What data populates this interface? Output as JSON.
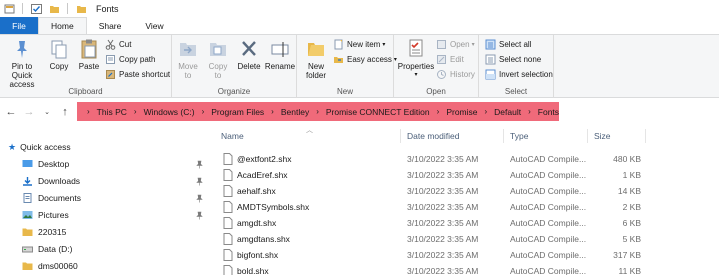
{
  "window": {
    "title": "Fonts"
  },
  "tabs": {
    "file": "File",
    "home": "Home",
    "share": "Share",
    "view": "View"
  },
  "ribbon": {
    "clipboard": {
      "label": "Clipboard",
      "pin_line1": "Pin to Quick",
      "pin_line2": "access",
      "copy": "Copy",
      "paste": "Paste",
      "cut": "Cut",
      "copy_path": "Copy path",
      "paste_shortcut": "Paste shortcut"
    },
    "organize": {
      "label": "Organize",
      "move_line1": "Move",
      "move_line2": "to",
      "copy_line1": "Copy",
      "copy_line2": "to",
      "delete": "Delete",
      "rename": "Rename"
    },
    "new": {
      "label": "New",
      "folder_line1": "New",
      "folder_line2": "folder",
      "new_item": "New item",
      "easy_access": "Easy access"
    },
    "open": {
      "label": "Open",
      "properties": "Properties",
      "open": "Open",
      "edit": "Edit",
      "history": "History"
    },
    "select": {
      "label": "Select",
      "select_all": "Select all",
      "select_none": "Select none",
      "invert": "Invert selection"
    }
  },
  "address": {
    "crumbs": [
      "This PC",
      "Windows (C:)",
      "Program Files",
      "Bentley",
      "Promise CONNECT Edition",
      "Promise",
      "Default",
      "Fonts"
    ],
    "highlight_color": "#f06a7a"
  },
  "nav": {
    "quick_access": "Quick access",
    "items": [
      "Desktop",
      "Downloads",
      "Documents",
      "Pictures",
      "220315",
      "Data (D:)",
      "dms00060"
    ]
  },
  "columns": {
    "name": "Name",
    "date": "Date modified",
    "type": "Type",
    "size": "Size"
  },
  "files": [
    {
      "name": "@extfont2.shx",
      "date": "3/10/2022 3:35 AM",
      "type": "AutoCAD Compile...",
      "size": "480 KB"
    },
    {
      "name": "AcadEref.shx",
      "date": "3/10/2022 3:35 AM",
      "type": "AutoCAD Compile...",
      "size": "1 KB"
    },
    {
      "name": "aehalf.shx",
      "date": "3/10/2022 3:35 AM",
      "type": "AutoCAD Compile...",
      "size": "14 KB"
    },
    {
      "name": "AMDTSymbols.shx",
      "date": "3/10/2022 3:35 AM",
      "type": "AutoCAD Compile...",
      "size": "2 KB"
    },
    {
      "name": "amgdt.shx",
      "date": "3/10/2022 3:35 AM",
      "type": "AutoCAD Compile...",
      "size": "6 KB"
    },
    {
      "name": "amgdtans.shx",
      "date": "3/10/2022 3:35 AM",
      "type": "AutoCAD Compile...",
      "size": "5 KB"
    },
    {
      "name": "bigfont.shx",
      "date": "3/10/2022 3:35 AM",
      "type": "AutoCAD Compile...",
      "size": "317 KB"
    },
    {
      "name": "bold.shx",
      "date": "3/10/2022 3:35 AM",
      "type": "AutoCAD Compile...",
      "size": "11 KB"
    }
  ]
}
